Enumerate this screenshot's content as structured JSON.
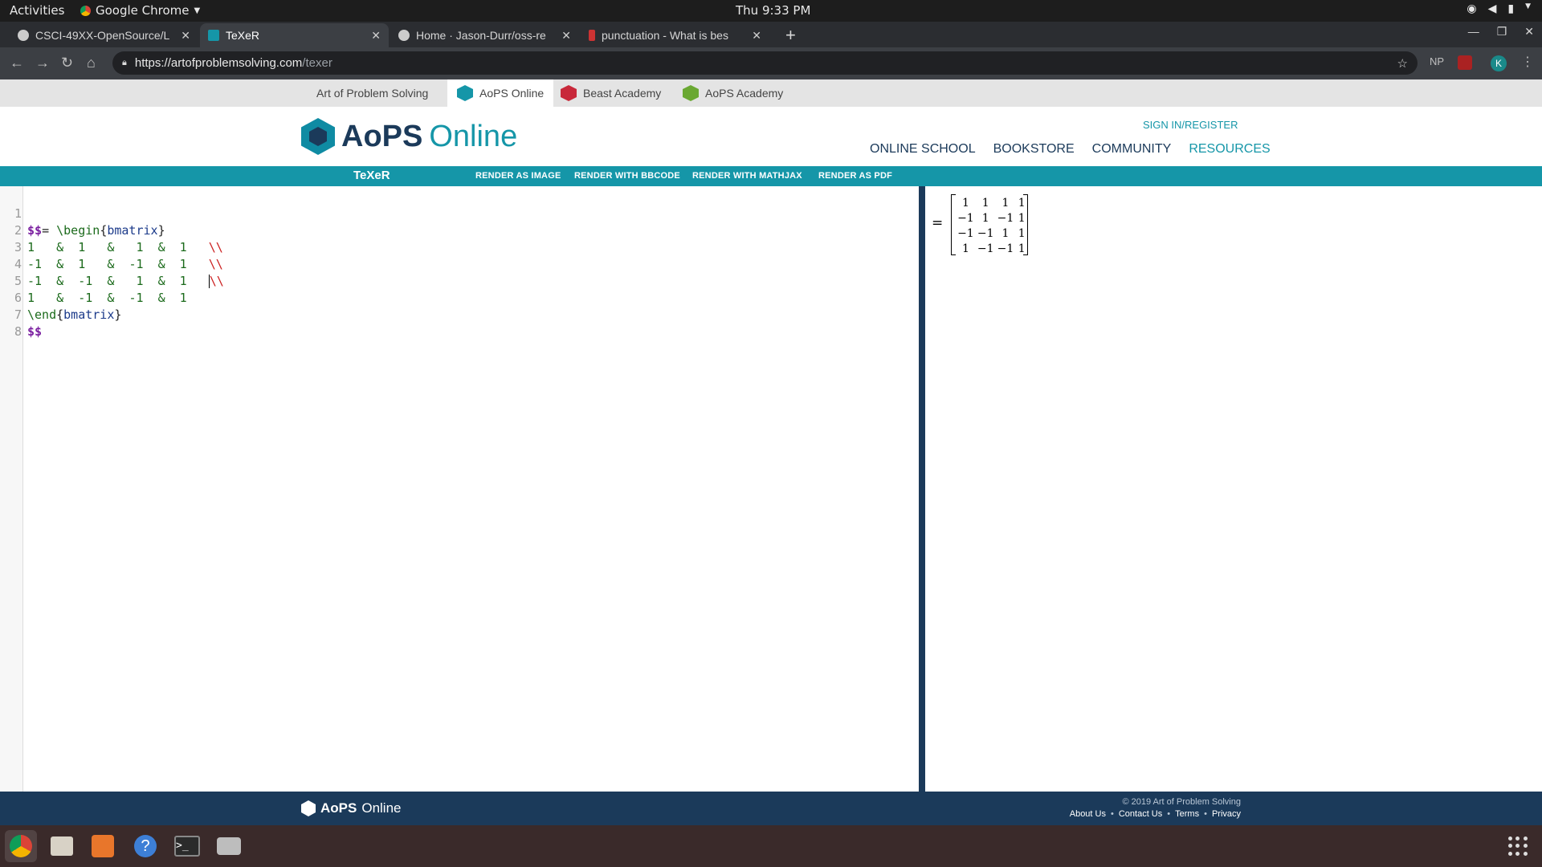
{
  "os": {
    "activities": "Activities",
    "app_name": "Google Chrome",
    "clock": "Thu  9:33 PM"
  },
  "browser": {
    "tabs": [
      {
        "title": "CSCI-49XX-OpenSource/L",
        "favicon_color": "#cccccc"
      },
      {
        "title": "TeXeR",
        "favicon_color": "#1596a8",
        "active": true
      },
      {
        "title": "Home · Jason-Durr/oss-re",
        "favicon_color": "#cccccc"
      },
      {
        "title": "punctuation - What is bes",
        "favicon_color": "#cc3333"
      }
    ],
    "url_host": "https://artofproblemsolving.com",
    "url_path": "/texer",
    "ext_np": "NP"
  },
  "network": {
    "items": [
      "Art of Problem Solving",
      "AoPS Online",
      "Beast Academy",
      "AoPS Academy"
    ]
  },
  "header": {
    "logo_aops": "AoPS",
    "logo_online": "Online",
    "signin": "SIGN IN/REGISTER",
    "nav": [
      "ONLINE SCHOOL",
      "BOOKSTORE",
      "COMMUNITY",
      "RESOURCES"
    ]
  },
  "texer": {
    "title": "TeXeR",
    "buttons": [
      "RENDER AS IMAGE",
      "RENDER WITH BBCODE",
      "RENDER WITH MATHJAX",
      "RENDER AS PDF"
    ]
  },
  "editor": {
    "line_numbers": [
      "1",
      "2",
      "3",
      "4",
      "5",
      "6",
      "7",
      "8"
    ],
    "l1": {
      "dollar": "$$",
      "eq": "= ",
      "cmd": "\\begin",
      "ob": "{",
      "arg": "bmatrix",
      "cb": "}"
    },
    "rows": [
      [
        "1 ",
        "1 ",
        " 1",
        "1"
      ],
      [
        "-1",
        "1 ",
        "-1",
        "1"
      ],
      [
        "-1",
        "-1",
        " 1",
        "1"
      ],
      [
        "1 ",
        "-1",
        "-1",
        "1"
      ]
    ],
    "amp": "&",
    "rowbreak": "\\\\",
    "l6": {
      "cmd": "\\end",
      "ob": "{",
      "arg": "bmatrix",
      "cb": "}"
    },
    "l7": "$$"
  },
  "preview": {
    "eq": "=",
    "matrix": [
      [
        "1",
        "1",
        "1",
        "1"
      ],
      [
        "−1",
        "1",
        "−1",
        "1"
      ],
      [
        "−1",
        "−1",
        "1",
        "1"
      ],
      [
        "1",
        "−1",
        "−1",
        "1"
      ]
    ]
  },
  "footer": {
    "logo_aops": "AoPS",
    "logo_online": "Online",
    "copyright": "© 2019 Art of Problem Solving",
    "links": [
      "About Us",
      "Contact Us",
      "Terms",
      "Privacy"
    ]
  }
}
